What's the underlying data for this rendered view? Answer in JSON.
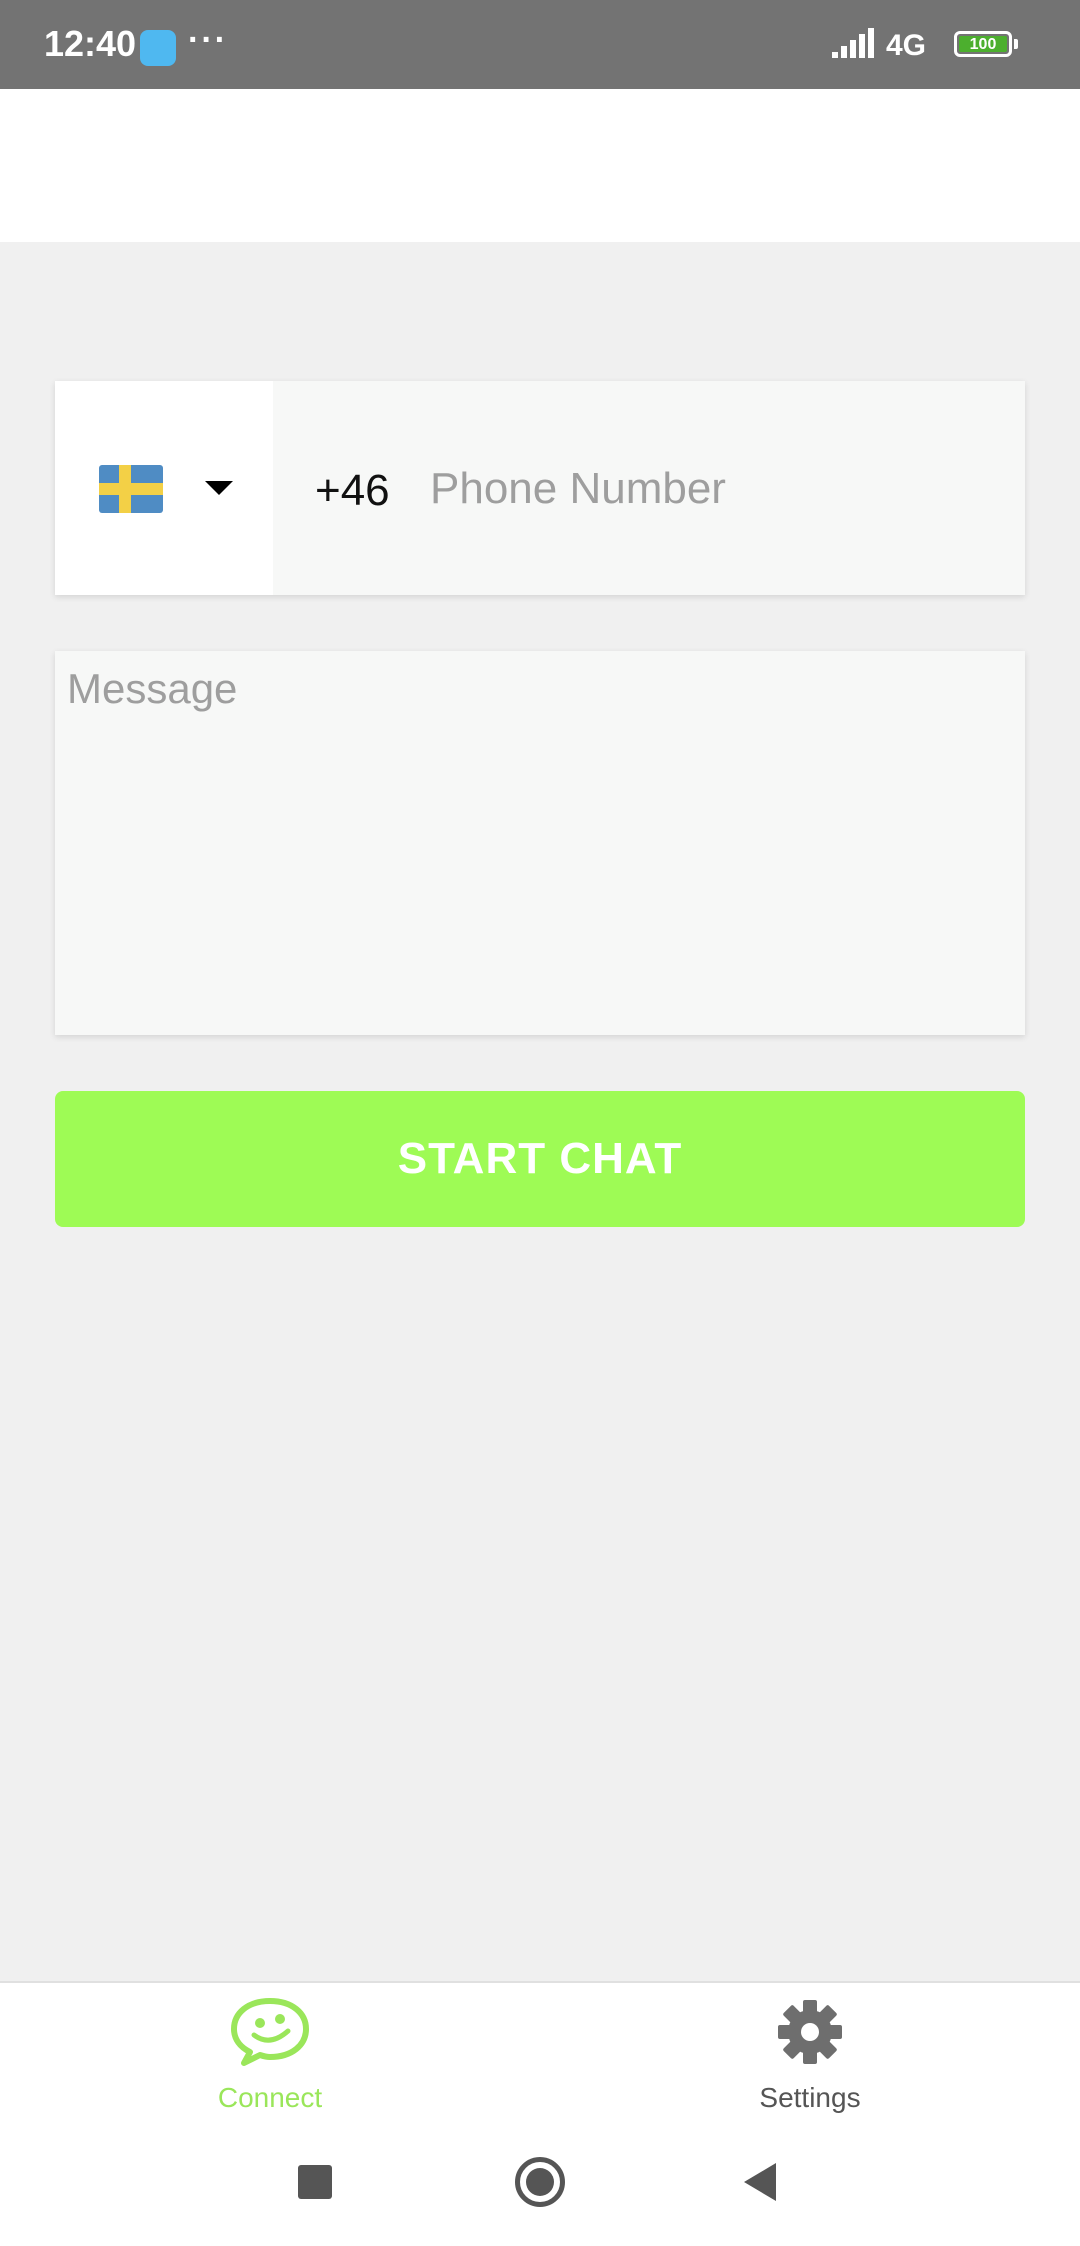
{
  "status_bar": {
    "time": "12:40",
    "dots": "···",
    "network": "4G",
    "battery": "100"
  },
  "form": {
    "country_flag": "sweden-flag",
    "dial_code": "+46",
    "phone_placeholder": "Phone Number",
    "phone_value": "",
    "message_placeholder": "Message",
    "message_value": "",
    "start_button_label": "START CHAT"
  },
  "bottom_nav": {
    "items": [
      {
        "label": "Connect",
        "icon": "chat-bubble-smile-icon",
        "active": true
      },
      {
        "label": "Settings",
        "icon": "gear-icon",
        "active": false
      }
    ]
  },
  "system_nav": {
    "icons": [
      "recents-square-icon",
      "home-circle-icon",
      "back-triangle-icon"
    ]
  },
  "colors": {
    "accent": "#9efb55",
    "active_nav": "#9ae65a",
    "status_bar": "#737373",
    "background": "#f0f0f0"
  }
}
